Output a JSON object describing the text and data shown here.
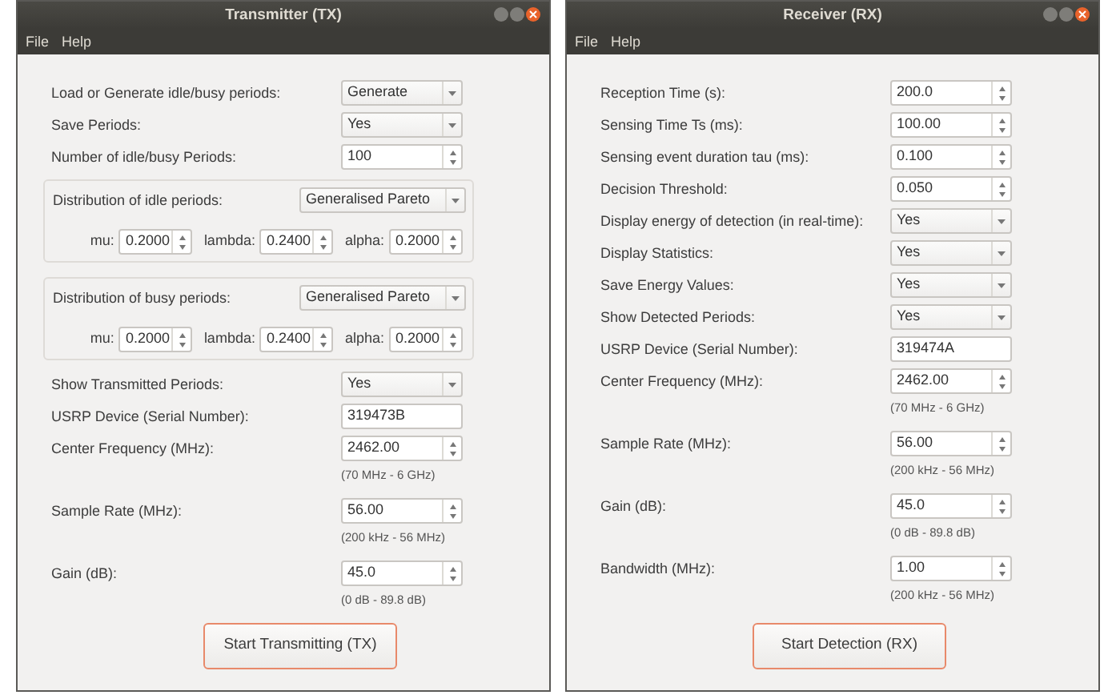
{
  "windows": [
    {
      "title": "Transmitter (TX)",
      "menu": [
        "File",
        "Help"
      ],
      "rows": [
        {
          "kind": "combo",
          "label": "Load or Generate idle/busy periods:",
          "value": "Generate"
        },
        {
          "kind": "combo",
          "label": "Save Periods:",
          "value": "Yes"
        },
        {
          "kind": "spin",
          "label": "Number of idle/busy Periods:",
          "value": "100"
        },
        {
          "kind": "group",
          "label": "Distribution of idle periods:",
          "value": "Generalised Pareto",
          "params": [
            {
              "label": "mu:",
              "value": "0.2000"
            },
            {
              "label": "lambda:",
              "value": "0.2400"
            },
            {
              "label": "alpha:",
              "value": "0.2000"
            }
          ]
        },
        {
          "kind": "group",
          "label": "Distribution of busy periods:",
          "value": "Generalised Pareto",
          "params": [
            {
              "label": "mu:",
              "value": "0.2000"
            },
            {
              "label": "lambda:",
              "value": "0.2400"
            },
            {
              "label": "alpha:",
              "value": "0.2000"
            }
          ]
        },
        {
          "kind": "combo",
          "label": "Show Transmitted Periods:",
          "value": "Yes"
        },
        {
          "kind": "text",
          "label": "USRP Device (Serial Number):",
          "value": "319473B"
        },
        {
          "kind": "spin",
          "label": "Center Frequency (MHz):",
          "value": "2462.00",
          "hint": "(70 MHz - 6 GHz)"
        },
        {
          "kind": "spin",
          "label": "Sample Rate (MHz):",
          "value": "56.00",
          "hint": "(200 kHz - 56 MHz)"
        },
        {
          "kind": "spin",
          "label": "Gain (dB):",
          "value": "45.0",
          "hint": "(0 dB - 89.8 dB)"
        }
      ],
      "button": "Start Transmitting (TX)"
    },
    {
      "title": "Receiver (RX)",
      "menu": [
        "File",
        "Help"
      ],
      "rows": [
        {
          "kind": "spin",
          "label": "Reception Time (s):",
          "value": "200.0"
        },
        {
          "kind": "spin",
          "label": "Sensing Time Ts (ms):",
          "value": "100.00"
        },
        {
          "kind": "spin",
          "label": "Sensing event duration tau (ms):",
          "value": "0.100"
        },
        {
          "kind": "spin",
          "label": "Decision Threshold:",
          "value": "0.050"
        },
        {
          "kind": "combo",
          "label": "Display energy of detection (in real-time):",
          "value": "Yes"
        },
        {
          "kind": "combo",
          "label": "Display Statistics:",
          "value": "Yes"
        },
        {
          "kind": "combo",
          "label": "Save Energy Values:",
          "value": "Yes"
        },
        {
          "kind": "combo",
          "label": "Show Detected Periods:",
          "value": "Yes"
        },
        {
          "kind": "text",
          "label": "USRP Device (Serial Number):",
          "value": "319474A"
        },
        {
          "kind": "spin",
          "label": "Center Frequency (MHz):",
          "value": "2462.00",
          "hint": "(70 MHz - 6 GHz)"
        },
        {
          "kind": "spin",
          "label": "Sample Rate (MHz):",
          "value": "56.00",
          "hint": "(200 kHz - 56 MHz)"
        },
        {
          "kind": "spin",
          "label": "Gain (dB):",
          "value": "45.0",
          "hint": "(0 dB - 89.8 dB)"
        },
        {
          "kind": "spin",
          "label": "Bandwidth (MHz):",
          "value": "1.00",
          "hint": "(200 kHz - 56 MHz)"
        }
      ],
      "button": "Start Detection (RX)"
    }
  ]
}
